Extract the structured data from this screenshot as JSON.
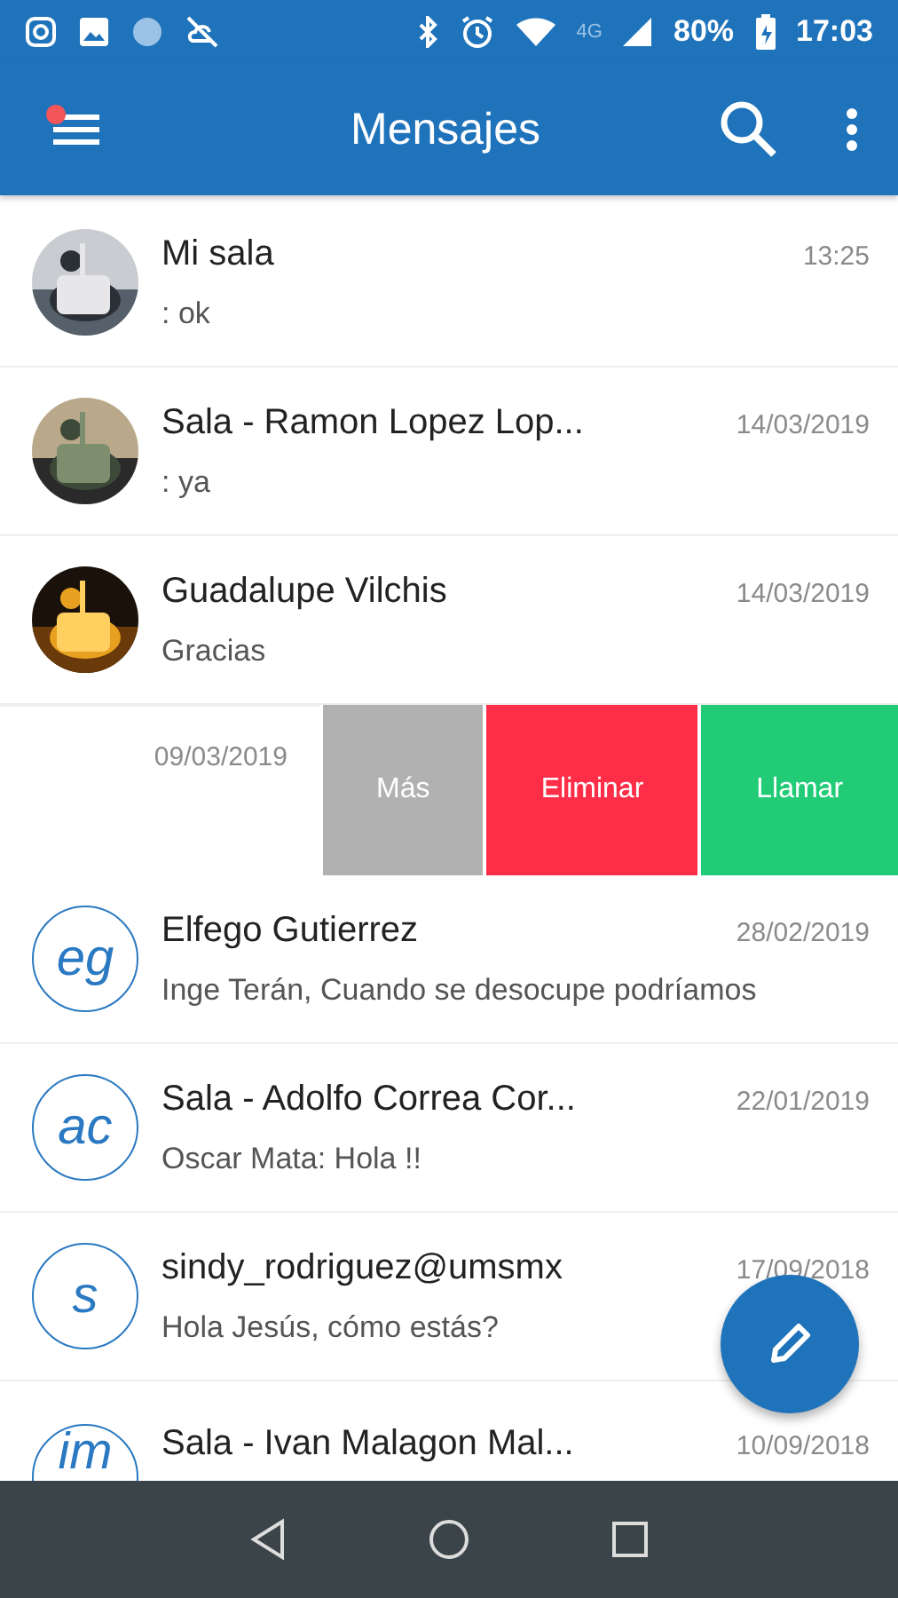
{
  "status_bar": {
    "network": "4G",
    "battery": "80%",
    "time": "17:03"
  },
  "app_bar": {
    "title": "Mensajes",
    "menu_badge": true
  },
  "conversations": [
    {
      "name": "Mi sala",
      "preview": ": ok",
      "date": "13:25"
    },
    {
      "name": "Sala - Ramon Lopez Lop...",
      "preview": ": ya",
      "date": "14/03/2019"
    },
    {
      "name": "Guadalupe Vilchis",
      "preview": "Gracias",
      "date": "14/03/2019"
    },
    {
      "kind": "swiped",
      "date": "09/03/2019",
      "actions": [
        {
          "label": "Más",
          "color": "#b1b1b1"
        },
        {
          "label": "Eliminar",
          "color": "#ff2e48"
        },
        {
          "label": "Llamar",
          "color": "#22cc77"
        }
      ]
    },
    {
      "kind": "initials",
      "initials": "eg",
      "name": "Elfego Gutierrez",
      "preview": "Inge Terán, Cuando se desocupe podríamos",
      "date": "28/02/2019"
    },
    {
      "kind": "initials",
      "initials": "ac",
      "name": "Sala - Adolfo Correa Cor...",
      "preview": "Oscar Mata: Hola !!",
      "date": "22/01/2019"
    },
    {
      "kind": "initials",
      "initials": "s",
      "name": "sindy_rodriguez@umsmx",
      "preview": "Hola Jesús, cómo estás?",
      "date": "17/09/2018"
    },
    {
      "kind": "initials",
      "initials": "im",
      "name": "Sala - Ivan Malagon Mal...",
      "date": "10/09/2018"
    }
  ]
}
